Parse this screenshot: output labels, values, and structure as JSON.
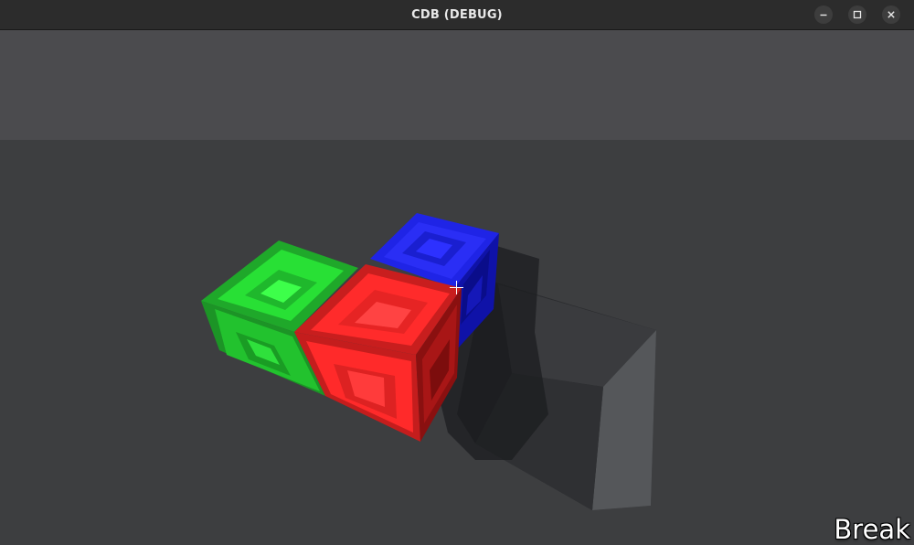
{
  "window": {
    "title": "CDB (DEBUG)"
  },
  "icons": {
    "minimize": "minimize-icon",
    "maximize": "maximize-icon",
    "close": "close-icon",
    "crosshair": "crosshair-icon"
  },
  "colors": {
    "titlebar": "#2c2c2c",
    "floor_tile": "#8a8b8d",
    "floor_grout": "#3c3d3f",
    "block_green": "#22e030",
    "block_red": "#ff2b2b",
    "block_blue": "#1f24e6"
  },
  "hud": {
    "mode_label": "Break"
  },
  "scene": {
    "blocks": [
      {
        "name": "green-block",
        "color": "green"
      },
      {
        "name": "red-block",
        "color": "red"
      },
      {
        "name": "blue-block",
        "color": "blue"
      }
    ],
    "hole_in_floor": true
  }
}
